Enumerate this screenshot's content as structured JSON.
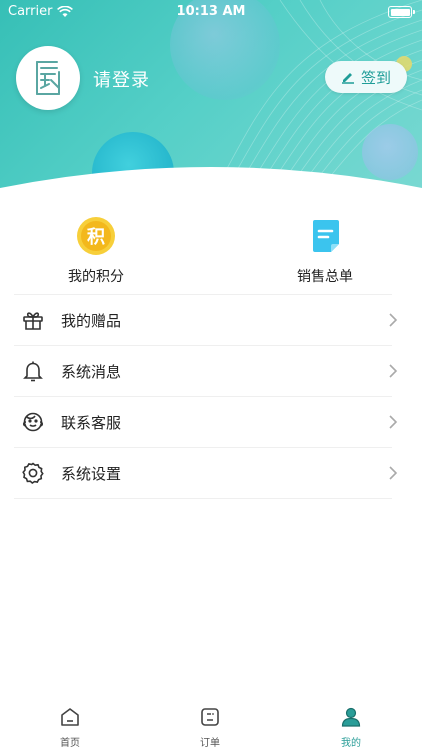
{
  "status_bar": {
    "carrier": "Carrier",
    "time": "10:13 AM"
  },
  "header": {
    "login_prompt": "请登录",
    "checkin_label": "签到"
  },
  "quick": [
    {
      "label": "我的积分",
      "badge": "积",
      "icon": "points-icon"
    },
    {
      "label": "销售总单",
      "icon": "sales-order-icon"
    }
  ],
  "menu": [
    {
      "label": "我的赠品",
      "icon": "gift-icon"
    },
    {
      "label": "系统消息",
      "icon": "bell-icon"
    },
    {
      "label": "联系客服",
      "icon": "customer-service-icon"
    },
    {
      "label": "系统设置",
      "icon": "gear-icon"
    }
  ],
  "tabbar": [
    {
      "label": "首页",
      "icon": "home-icon"
    },
    {
      "label": "订单",
      "icon": "order-icon"
    },
    {
      "label": "我的",
      "icon": "profile-icon",
      "active": true
    }
  ],
  "colors": {
    "accent": "#2a9d98",
    "header_start": "#36bfb6",
    "header_end": "#7ad9d2",
    "points_gold": "#f3b81c"
  }
}
